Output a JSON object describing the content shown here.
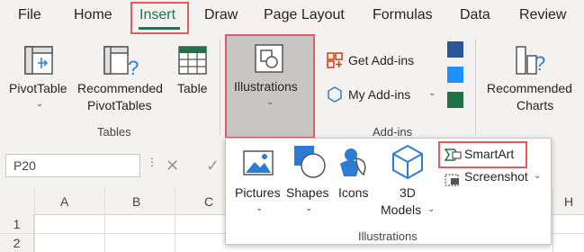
{
  "tabs": [
    "File",
    "Home",
    "Insert",
    "Draw",
    "Page Layout",
    "Formulas",
    "Data",
    "Review"
  ],
  "active_tab": "Insert",
  "ribbon": {
    "tables_group": {
      "label": "Tables",
      "pivottable": "PivotTable",
      "recommended_line1": "Recommended",
      "recommended_line2": "PivotTables",
      "table": "Table"
    },
    "illustrations": "Illustrations",
    "addins_group": {
      "label": "Add-ins",
      "get_addins": "Get Add-ins",
      "my_addins": "My Add-ins"
    },
    "charts": {
      "line1": "Recommended",
      "line2": "Charts"
    }
  },
  "formula_bar": {
    "name_box": "P20"
  },
  "columns": [
    "A",
    "B",
    "C",
    "H"
  ],
  "rows": [
    "1",
    "2"
  ],
  "illustrations_menu": {
    "pictures": "Pictures",
    "shapes": "Shapes",
    "icons": "Icons",
    "models_line1": "3D",
    "models_line2": "Models",
    "smartart": "SmartArt",
    "screenshot": "Screenshot",
    "group_label": "Illustrations"
  },
  "colors": {
    "accent_green": "#217346",
    "highlight_red": "#e15c5c",
    "icon_blue": "#2b7cd3"
  }
}
